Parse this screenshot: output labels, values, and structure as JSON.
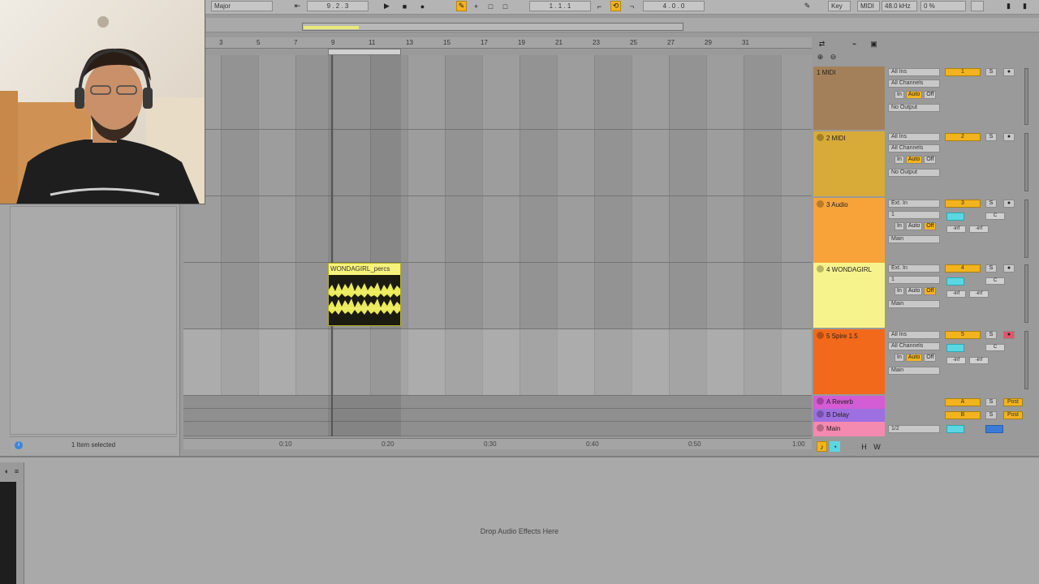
{
  "transport": {
    "scale_value": "Major",
    "position": "9 . 2 . 3",
    "loop_start": "1 . 1 . 1",
    "loop_length": "4 . 0 . 0",
    "key_label": "Key",
    "midi_label": "MIDI",
    "cpu": "48.0 kHz",
    "cpu_pct": "0 %"
  },
  "ruler": {
    "bars": [
      "3",
      "5",
      "7",
      "9",
      "11",
      "13",
      "15",
      "17",
      "19",
      "21",
      "23",
      "25",
      "27",
      "29",
      "31"
    ]
  },
  "time_ruler": {
    "ticks": [
      "0:10",
      "0:20",
      "0:30",
      "0:40",
      "0:50",
      "1:00"
    ]
  },
  "clip": {
    "title": "WONDAGIRL_percs"
  },
  "tracks": [
    {
      "name": "1 MIDI",
      "color": "#a4805a",
      "input": "All Ins",
      "channel": "All Channels",
      "output": "No Output",
      "number": "1"
    },
    {
      "name": "2 MIDI",
      "color": "#d8ab38",
      "input": "All Ins",
      "channel": "All Channels",
      "output": "No Output",
      "number": "2"
    },
    {
      "name": "3 Audio",
      "color": "#f7a33a",
      "input": "Ext. In",
      "channel": "1",
      "output": "Main",
      "number": "3"
    },
    {
      "name": "4 WONDAGIRL",
      "color": "#f7f38c",
      "input": "Ext. In",
      "channel": "1",
      "output": "Main",
      "number": "4"
    },
    {
      "name": "5 Spire 1.5",
      "color": "#f2691b",
      "input": "All Ins",
      "channel": "All Channels",
      "output": "Main",
      "number": "5"
    }
  ],
  "returns": [
    {
      "name": "A Reverb",
      "color": "#d45cd4",
      "letter": "A",
      "mode": "Post"
    },
    {
      "name": "B Delay",
      "color": "#9d6fe0",
      "letter": "B",
      "mode": "Post"
    }
  ],
  "main": {
    "name": "Main",
    "color": "#f48ab0",
    "io": "1/2"
  },
  "monitor": {
    "in": "In",
    "auto": "Auto",
    "off": "Off"
  },
  "browser": {
    "status": "1 Item selected",
    "info_symbol": "i"
  },
  "device_panel": {
    "drop_text": "Drop Audio Effects Here"
  },
  "colors": {
    "accent": "#f2b31e",
    "send": "#5ad7e2",
    "clip": "#f7f27b"
  }
}
